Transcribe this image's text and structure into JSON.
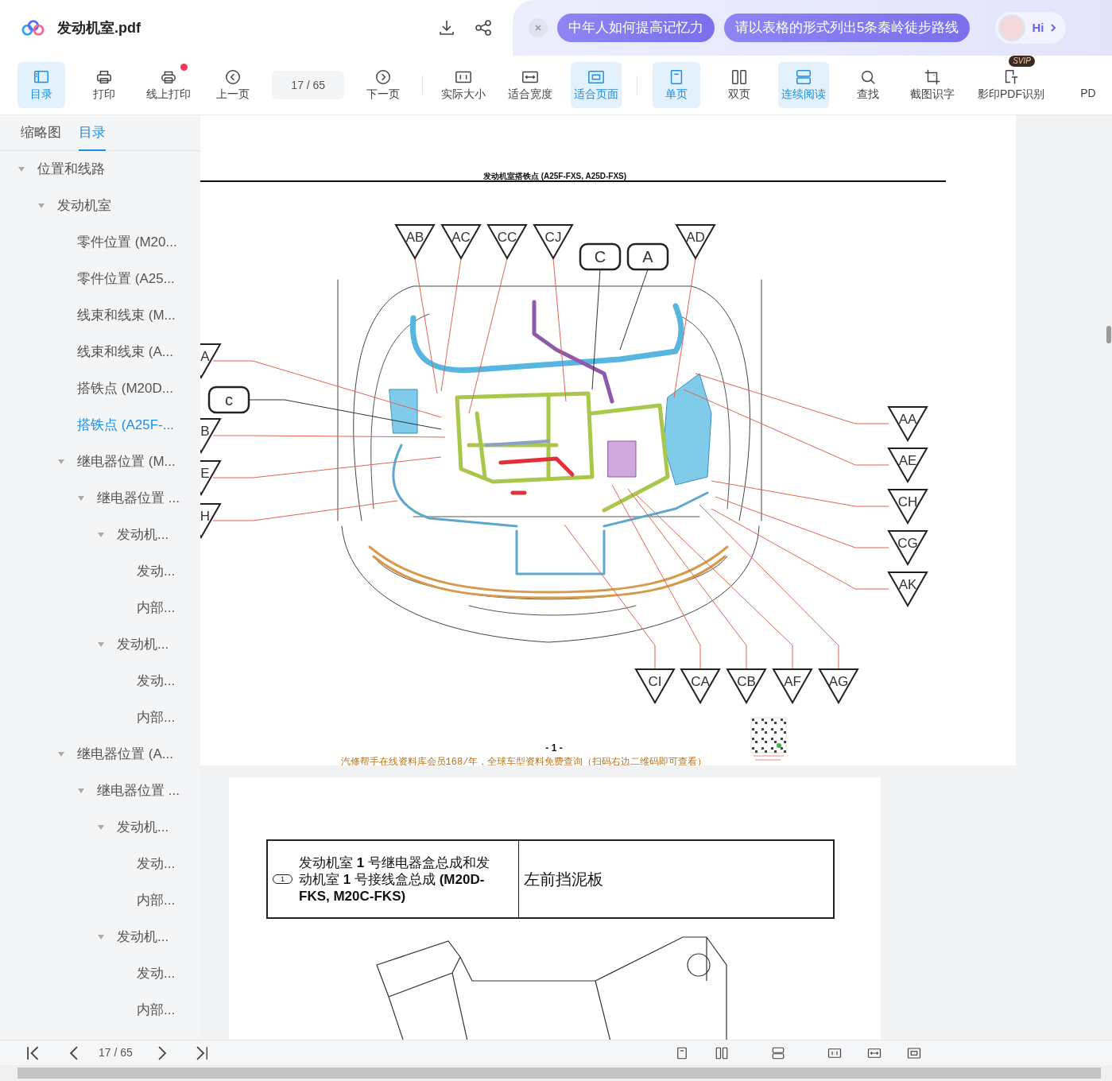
{
  "header": {
    "title": "发动机室.pdf",
    "suggestions": [
      "中年人如何提高记忆力",
      "请以表格的形式列出5条秦岭徒步路线"
    ],
    "assistant": "Hi"
  },
  "toolbar": [
    {
      "kind": "button",
      "label": "目录",
      "selected": true,
      "dot": false
    },
    {
      "kind": "button",
      "label": "打印",
      "selected": false,
      "dot": false
    },
    {
      "kind": "button",
      "label": "线上打印",
      "selected": false,
      "dot": true
    },
    {
      "kind": "button",
      "label": "上一页",
      "selected": false,
      "dot": false
    },
    {
      "kind": "page",
      "value": "17 / 65"
    },
    {
      "kind": "button",
      "label": "下一页",
      "selected": false,
      "dot": false
    },
    {
      "kind": "button",
      "label": "实际大小",
      "selected": false,
      "dot": false
    },
    {
      "kind": "button",
      "label": "适合宽度",
      "selected": false,
      "dot": false
    },
    {
      "kind": "button",
      "label": "适合页面",
      "selected": true,
      "dot": false
    },
    {
      "kind": "button",
      "label": "单页",
      "selected": true,
      "dot": false
    },
    {
      "kind": "button",
      "label": "双页",
      "selected": false,
      "dot": false
    },
    {
      "kind": "button",
      "label": "连续阅读",
      "selected": true,
      "dot": false
    },
    {
      "kind": "button",
      "label": "查找",
      "selected": false,
      "dot": false
    },
    {
      "kind": "button",
      "label": "截图识字",
      "selected": false,
      "dot": false
    },
    {
      "kind": "button",
      "label": "影印PDF识别",
      "selected": false,
      "dot": false,
      "badge": "SVIP"
    },
    {
      "kind": "button",
      "label": "PD",
      "selected": false,
      "dot": false
    }
  ],
  "sidebar": {
    "tabs": [
      {
        "label": "缩略图",
        "selected": false
      },
      {
        "label": "目录",
        "selected": true
      }
    ],
    "tree": [
      {
        "label": "位置和线路",
        "selected": false,
        "expanded": true,
        "children": [
          {
            "label": "发动机室",
            "selected": false,
            "expanded": true,
            "children": [
              {
                "label": "零件位置 (M20...",
                "selected": false
              },
              {
                "label": "零件位置 (A25...",
                "selected": false
              },
              {
                "label": "线束和线束 (M...",
                "selected": false
              },
              {
                "label": "线束和线束 (A...",
                "selected": false
              },
              {
                "label": "搭铁点 (M20D...",
                "selected": false
              },
              {
                "label": "搭铁点 (A25F-...",
                "selected": true
              },
              {
                "label": "继电器位置 (M...",
                "selected": false,
                "expanded": true,
                "children": [
                  {
                    "label": "继电器位置 ...",
                    "selected": false,
                    "expanded": true,
                    "children": [
                      {
                        "label": "发动机...",
                        "selected": false,
                        "expanded": true,
                        "children": [
                          {
                            "label": "发动...",
                            "selected": false
                          },
                          {
                            "label": "内部...",
                            "selected": false
                          }
                        ]
                      },
                      {
                        "label": "发动机...",
                        "selected": false,
                        "expanded": true,
                        "children": [
                          {
                            "label": "发动...",
                            "selected": false
                          },
                          {
                            "label": "内部...",
                            "selected": false
                          }
                        ]
                      }
                    ]
                  }
                ]
              },
              {
                "label": "继电器位置 (A...",
                "selected": false,
                "expanded": true,
                "children": [
                  {
                    "label": "继电器位置 ...",
                    "selected": false,
                    "expanded": true,
                    "children": [
                      {
                        "label": "发动机...",
                        "selected": false,
                        "expanded": true,
                        "children": [
                          {
                            "label": "发动...",
                            "selected": false
                          },
                          {
                            "label": "内部...",
                            "selected": false
                          }
                        ]
                      },
                      {
                        "label": "发动机...",
                        "selected": false,
                        "expanded": true,
                        "children": [
                          {
                            "label": "发动...",
                            "selected": false
                          },
                          {
                            "label": "内部...",
                            "selected": false
                          }
                        ]
                      }
                    ]
                  }
                ]
              }
            ]
          }
        ]
      }
    ]
  },
  "page1": {
    "heading": "发动机室搭铁点 (A25F-FXS, A25D-FXS)",
    "callouts": {
      "top": [
        {
          "label": "AB",
          "kind": "triangle"
        },
        {
          "label": "AC",
          "kind": "triangle"
        },
        {
          "label": "CC",
          "kind": "triangle"
        },
        {
          "label": "CJ",
          "kind": "triangle"
        },
        {
          "label": "C",
          "kind": "tag"
        },
        {
          "label": "A",
          "kind": "tag"
        },
        {
          "label": "AD",
          "kind": "triangle"
        }
      ],
      "left": [
        {
          "label": "A",
          "kind": "triangle"
        },
        {
          "label": "c",
          "kind": "tag"
        },
        {
          "label": "B",
          "kind": "triangle"
        },
        {
          "label": "E",
          "kind": "triangle"
        },
        {
          "label": "H",
          "kind": "triangle"
        }
      ],
      "right": [
        {
          "label": "AA",
          "kind": "triangle"
        },
        {
          "label": "AE",
          "kind": "triangle"
        },
        {
          "label": "CH",
          "kind": "triangle"
        },
        {
          "label": "CG",
          "kind": "triangle"
        },
        {
          "label": "AK",
          "kind": "triangle"
        }
      ],
      "bottom": [
        {
          "label": "CI",
          "kind": "triangle"
        },
        {
          "label": "CA",
          "kind": "triangle"
        },
        {
          "label": "CB",
          "kind": "triangle"
        },
        {
          "label": "AF",
          "kind": "triangle"
        },
        {
          "label": "AG",
          "kind": "triangle"
        }
      ]
    },
    "page_number": "- 1 -",
    "footer": "汽修帮手在线资料库会员168/年，全球车型资料免费查询（扫码右边二维码即可查看）"
  },
  "page2": {
    "rows": [
      {
        "index": "1",
        "part": "发动机室 **1** 号继电器盒总成和发动机室 **1** 号接线盒总成 **(M20D-FKS, M20C-FKS)**",
        "location": "左前挡泥板"
      }
    ]
  },
  "bottom_bar": {
    "page": "17 / 65"
  }
}
